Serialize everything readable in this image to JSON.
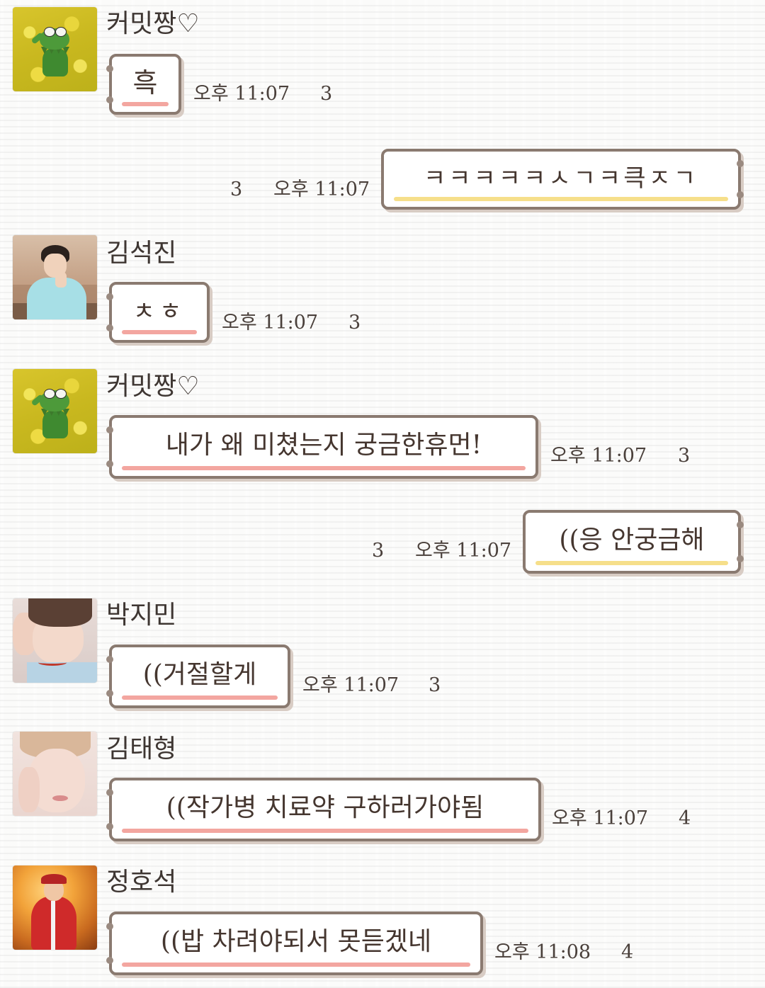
{
  "messages": [
    {
      "sender": "커밋짱♡",
      "text": "흑",
      "time": "오후 11:07",
      "unread": "3",
      "side": "in"
    },
    {
      "sender": "",
      "text": "ㅋㅋㅋㅋㅋㅅㄱㅋ큭ㅈㄱ",
      "time": "오후 11:07",
      "unread": "3",
      "side": "out"
    },
    {
      "sender": "김석진",
      "text": "ㅊㅎ",
      "time": "오후 11:07",
      "unread": "3",
      "side": "in"
    },
    {
      "sender": "커밋짱♡",
      "text": "내가 왜 미쳤는지 궁금한휴먼!",
      "time": "오후 11:07",
      "unread": "3",
      "side": "in"
    },
    {
      "sender": "",
      "text": "((응 안궁금해",
      "time": "오후 11:07",
      "unread": "3",
      "side": "out"
    },
    {
      "sender": "박지민",
      "text": "((거절할게",
      "time": "오후 11:07",
      "unread": "3",
      "side": "in"
    },
    {
      "sender": "김태형",
      "text": "((작가병 치료약 구하러가야됨",
      "time": "오후 11:07",
      "unread": "4",
      "side": "in"
    },
    {
      "sender": "정호석",
      "text": "((밥 차려야되서 못듣겠네",
      "time": "오후 11:08",
      "unread": "4",
      "side": "in"
    }
  ],
  "colors": {
    "incoming_underline": "#f3a6a0",
    "outgoing_underline": "#f6df8a",
    "bubble_border": "#8a7a70",
    "text": "#45362f"
  },
  "icons": {
    "avatar_kermit": "kermit-avatar-icon",
    "avatar_jin": "jin-avatar-icon",
    "avatar_jimin": "jimin-avatar-icon",
    "avatar_v": "taehyung-avatar-icon",
    "avatar_hoseok": "hoseok-avatar-icon"
  }
}
